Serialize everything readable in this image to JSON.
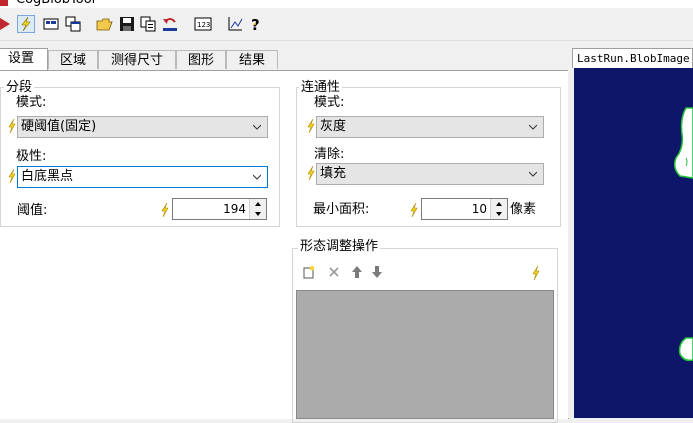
{
  "window": {
    "title": "CogBlobTool"
  },
  "toolbar": {
    "icons": [
      "run-icon",
      "electric-icon",
      "show-image-icon",
      "image-window-icon",
      "open-icon",
      "save-icon",
      "copy-icon",
      "reset-icon",
      "number-icon",
      "chart-icon",
      "help-icon"
    ]
  },
  "tabs": [
    {
      "label": "设置",
      "active": true
    },
    {
      "label": "区域",
      "active": false
    },
    {
      "label": "测得尺寸",
      "active": false
    },
    {
      "label": "图形",
      "active": false
    },
    {
      "label": "结果",
      "active": false
    }
  ],
  "segment": {
    "group_label": "分段",
    "mode_label": "模式:",
    "mode_value": "硬阈值(固定)",
    "polarity_label": "极性:",
    "polarity_value": "白底黑点",
    "threshold_label": "阈值:",
    "threshold_value": "194"
  },
  "connectivity": {
    "group_label": "连通性",
    "mode_label": "模式:",
    "mode_value": "灰度",
    "clean_label": "清除:",
    "clean_value": "填充",
    "min_area_label": "最小面积:",
    "min_area_value": "10",
    "unit_label": "像素"
  },
  "morphology": {
    "group_label": "形态调整操作"
  },
  "image_pane": {
    "tab_label": "LastRun.BlobImage"
  },
  "colors": {
    "accent": "#0078d7",
    "bolt": "#f2d21b",
    "image_bg": "#0d1669",
    "blob": "#ffffff"
  }
}
